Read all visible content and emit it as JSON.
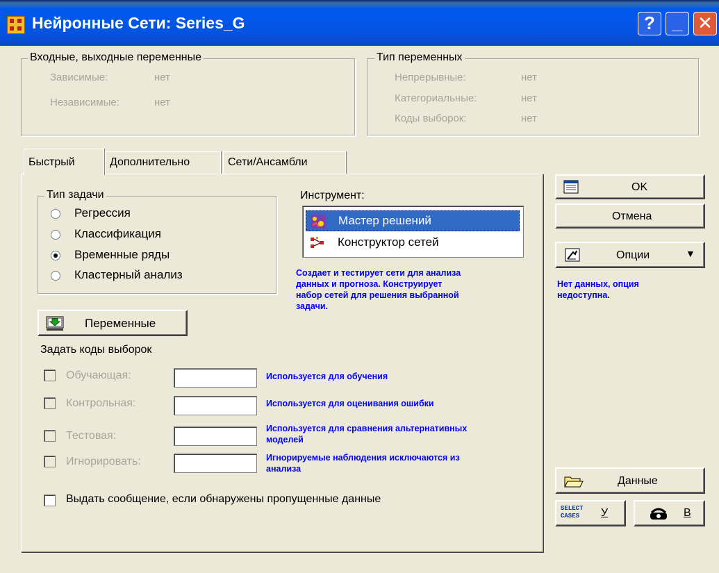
{
  "window": {
    "title": "Нейронные Сети: Series_G",
    "help": "?",
    "minimize": "_",
    "close": "✕"
  },
  "io_group": {
    "label": "Входные, выходные переменные",
    "dependent_label": "Зависимые:",
    "dependent_value": "нет",
    "independent_label": "Независимые:",
    "independent_value": "нет"
  },
  "type_group": {
    "label": "Тип переменных",
    "continuous_label": "Непрерывные:",
    "continuous_value": "нет",
    "categorical_label": "Категориальные:",
    "categorical_value": "нет",
    "codes_label": "Коды выборок:",
    "codes_value": "нет"
  },
  "tabs": [
    {
      "label": "Быстрый",
      "active": true
    },
    {
      "label": "Дополнительно",
      "active": false
    },
    {
      "label": "Сети/Ансамбли",
      "active": false
    }
  ],
  "task_group": {
    "label": "Тип задачи",
    "options": [
      {
        "label": "Регрессия",
        "checked": false
      },
      {
        "label": "Классификация",
        "checked": false
      },
      {
        "label": "Временные ряды",
        "checked": true
      },
      {
        "label": "Кластерный анализ",
        "checked": false
      }
    ]
  },
  "tool": {
    "label": "Инструмент:",
    "items": [
      {
        "label": "Мастер решений",
        "selected": true,
        "icon": "wizard-icon"
      },
      {
        "label": "Конструктор сетей",
        "selected": false,
        "icon": "network-builder-icon"
      }
    ],
    "description": [
      "Создает и тестирует сети для анализа",
      "данных и прогноза. Конструирует",
      "набор сетей для решения выбранной",
      "задачи."
    ]
  },
  "variables_button": "Переменные",
  "codes": {
    "heading": "Задать коды выборок",
    "rows": [
      {
        "label": "Обучающая:",
        "value": "",
        "hint": [
          "Используется для обучения"
        ]
      },
      {
        "label": "Контрольная:",
        "value": "",
        "hint": [
          "Используется для оценивания ошибки"
        ]
      },
      {
        "label": "Тестовая:",
        "value": "",
        "hint": [
          "Используется для сравнения альтернативных",
          "моделей"
        ]
      },
      {
        "label": "Игнорировать:",
        "value": "",
        "hint": [
          "Игнорируемые наблюдения исключаются из",
          "анализа"
        ]
      }
    ]
  },
  "missing_checkbox": "Выдать сообщение, если обнаружены пропущенные данные",
  "right": {
    "ok": "OK",
    "cancel": "Отмена",
    "options": "Опции",
    "options_note": [
      "Нет данных, опция",
      "недоступна."
    ],
    "data": "Данные",
    "select_cases_icon_text": [
      "SELECT",
      "CASES"
    ],
    "select_cases_letter": "У",
    "weight_letter": "В"
  }
}
